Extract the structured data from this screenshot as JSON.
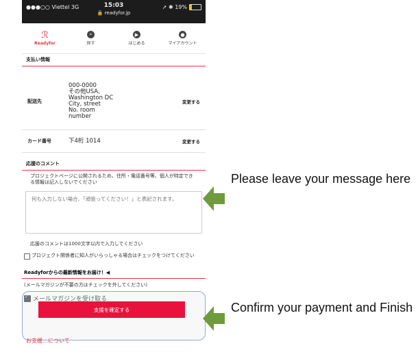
{
  "status_bar": {
    "carrier": "●●●○○ Viettel  3G",
    "time": "15:03",
    "url": "🔒 readyfor.jp",
    "right": "➚ ✱ 19%",
    "battery_percent": 19
  },
  "nav": {
    "items": [
      {
        "label": "Readyfor",
        "icon": "readyfor-logo"
      },
      {
        "label": "探す",
        "icon": "search-icon"
      },
      {
        "label": "はじめる",
        "icon": "play-icon"
      },
      {
        "label": "マイアカウント",
        "icon": "account-icon"
      }
    ]
  },
  "payment": {
    "heading": "支払い情報",
    "rows": [
      {
        "label": "配送先",
        "value": "000-0000\nその他USA,\nWashington DC\nCity, street\nNo.  room\nnumber",
        "action": "変更する"
      },
      {
        "label": "カード番号",
        "value": "下4桁 1014",
        "action": "変更する"
      }
    ]
  },
  "comment": {
    "heading": "応援のコメント",
    "note": "プロジェクトページに公開されるため、住所・電話番号等、個人が特定できる情報は記入しないでください",
    "placeholder": "何も入力しない場合、「頑張ってください！」と表記されます。",
    "limit": "応援のコメントは1000文字以内で入力してください",
    "acquaintance_check": "プロジェクト関係者に知人がいらっしゃる場合はチェックをつけてください"
  },
  "newsletter": {
    "heading": "Readyforからの最新情報をお届け！◀",
    "sub": "(メールマガジンが不要の方はチェックを外してください)",
    "checkbox_label": "メールマガジンを受け取る",
    "checked": true
  },
  "confirm_button": "支援を確定する",
  "cut_link": "お支援…について",
  "annotations": {
    "message": "Please leave your message here",
    "confirm": "Confirm your payment and Finish"
  },
  "colors": {
    "accent": "#e8333f",
    "button": "#e8123c",
    "arrow": "#6f9a3e",
    "highlight_border": "#8fa8d6"
  }
}
